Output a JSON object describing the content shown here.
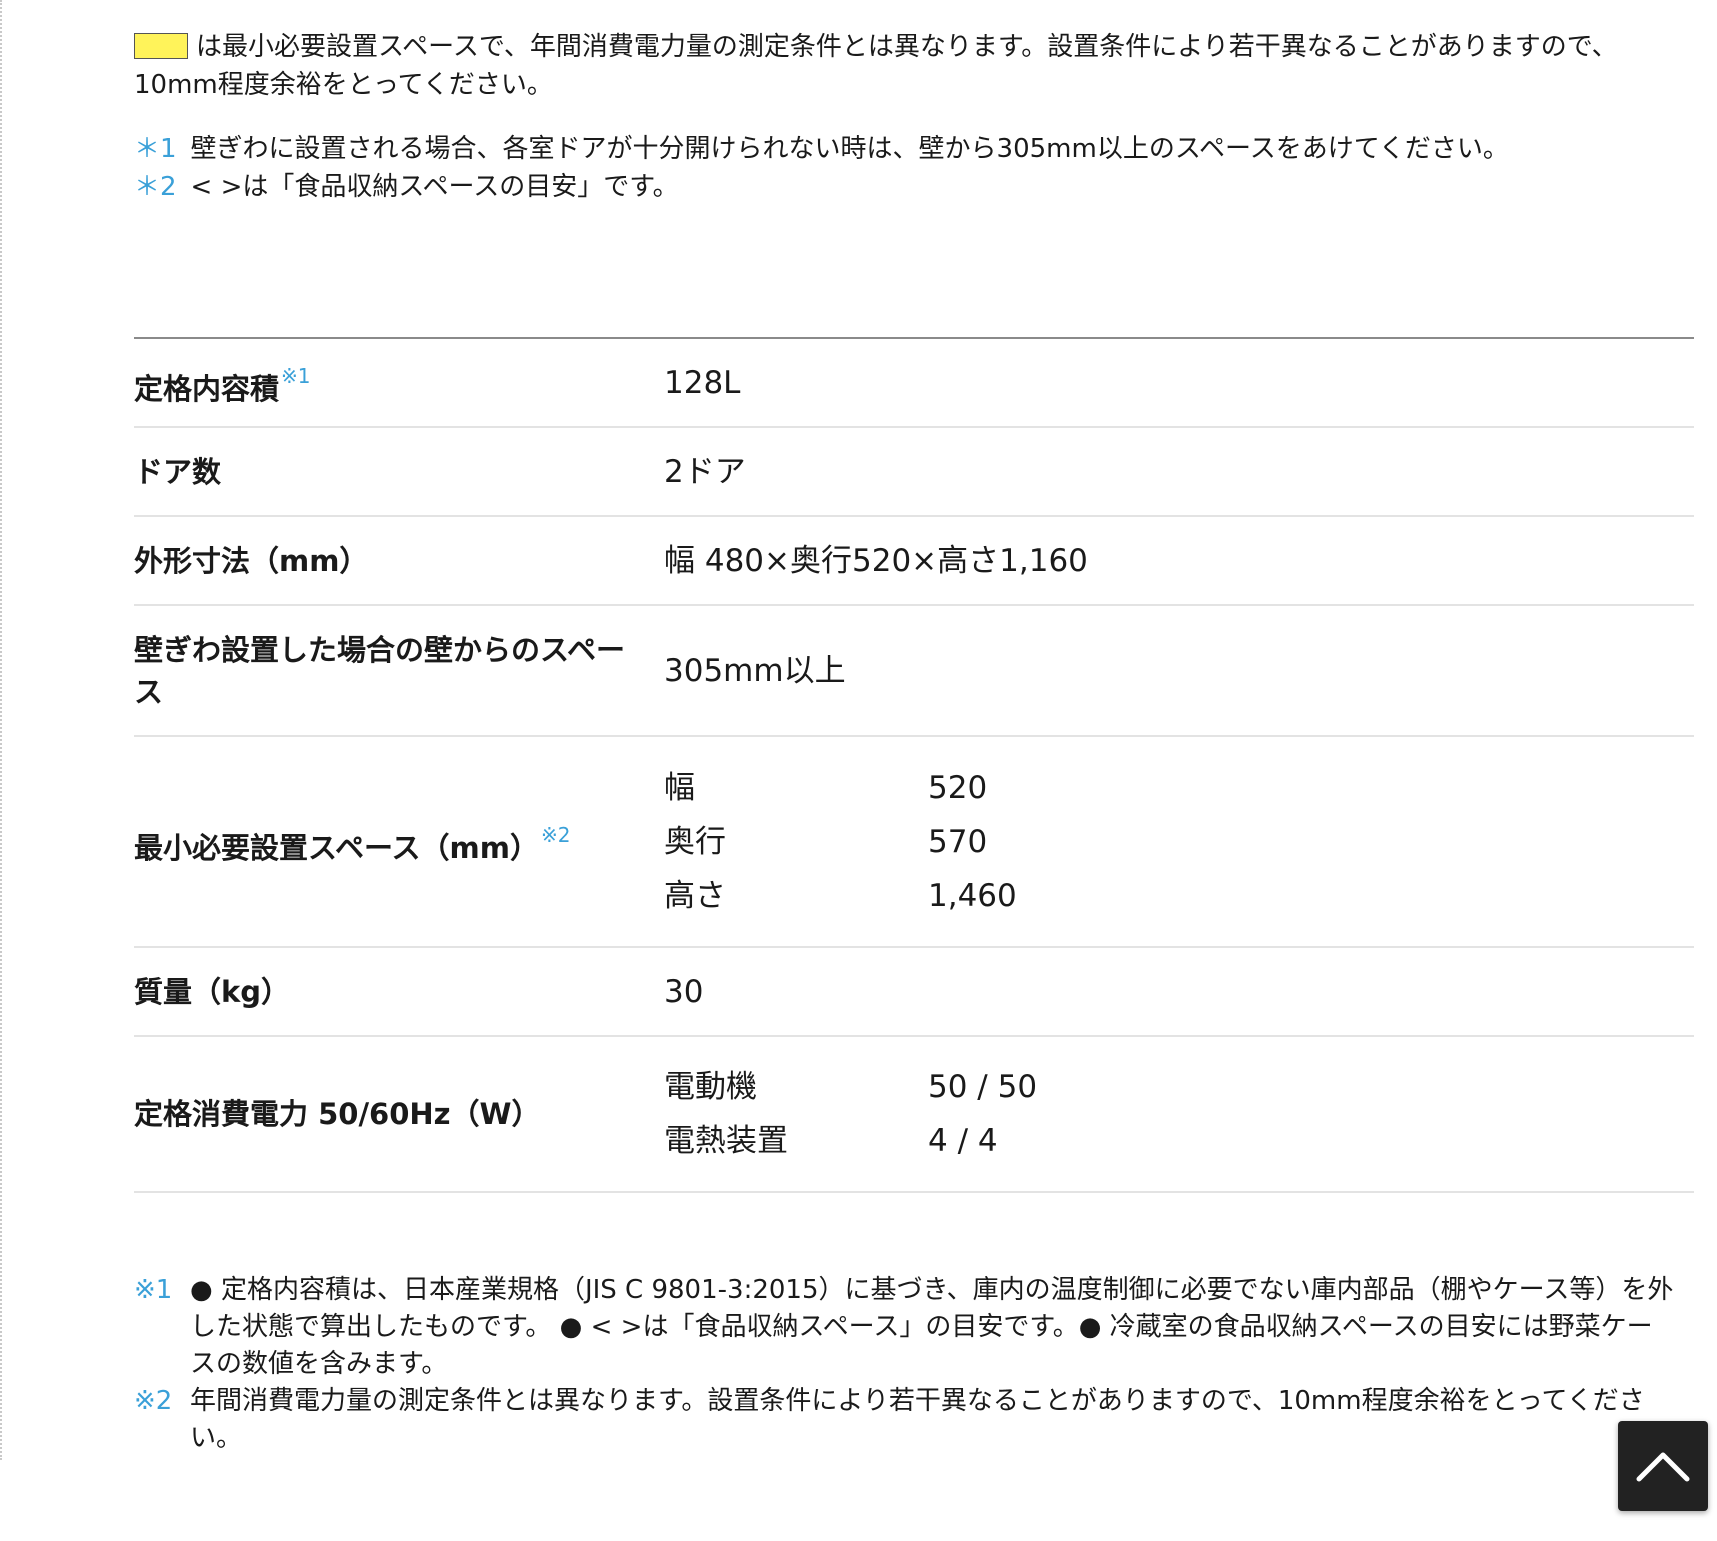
{
  "intro": {
    "text": "は最小必要設置スペースで、年間消費電力量の測定条件とは異なります。設置条件により若干異なることがありますので、10mm程度余裕をとってください。",
    "swatch_color": "#fff35a"
  },
  "top_notes": [
    {
      "mark": "＊1",
      "text": "壁ぎわに設置される場合、各室ドアが十分開けられない時は、壁から305mm以上のスペースをあけてください。"
    },
    {
      "mark": "＊2",
      "text": "< >は「食品収納スペースの目安」です。"
    }
  ],
  "specs": {
    "capacity": {
      "label": "定格内容積",
      "sup": "※1",
      "value": "128L"
    },
    "doors": {
      "label": "ドア数",
      "value": "2ドア"
    },
    "dimensions": {
      "label": "外形寸法（mm）",
      "value": "幅 480×奥行520×高さ1,160"
    },
    "wall_space": {
      "label": "壁ぎわ設置した場合の壁からのスペース",
      "value": "305mm以上"
    },
    "min_space": {
      "label": "最小必要設置スペース（mm）",
      "sup": "※2",
      "items": [
        {
          "name": "幅",
          "value": "520"
        },
        {
          "name": "奥行",
          "value": "570"
        },
        {
          "name": "高さ",
          "value": "1,460"
        }
      ]
    },
    "mass": {
      "label": "質量（kg）",
      "value": "30"
    },
    "power": {
      "label": "定格消費電力 50/60Hz（W）",
      "items": [
        {
          "name": "電動機",
          "value": "50 / 50"
        },
        {
          "name": "電熱装置",
          "value": "4 / 4"
        }
      ]
    }
  },
  "footnotes": [
    {
      "mark": "※1",
      "text": "● 定格内容積は、日本産業規格（JIS C 9801-3:2015）に基づき、庫内の温度制御に必要でない庫内部品（棚やケース等）を外した状態で算出したものです。 ● < >は「食品収納スペース」の目安です。● 冷蔵室の食品収納スペースの目安には野菜ケースの数値を含みます。"
    },
    {
      "mark": "※2",
      "text": "年間消費電力量の測定条件とは異なります。設置条件により若干異なることがありますので、10mm程度余裕をとってください。"
    }
  ],
  "back_to_top": {
    "icon": "chevron-up-icon"
  }
}
